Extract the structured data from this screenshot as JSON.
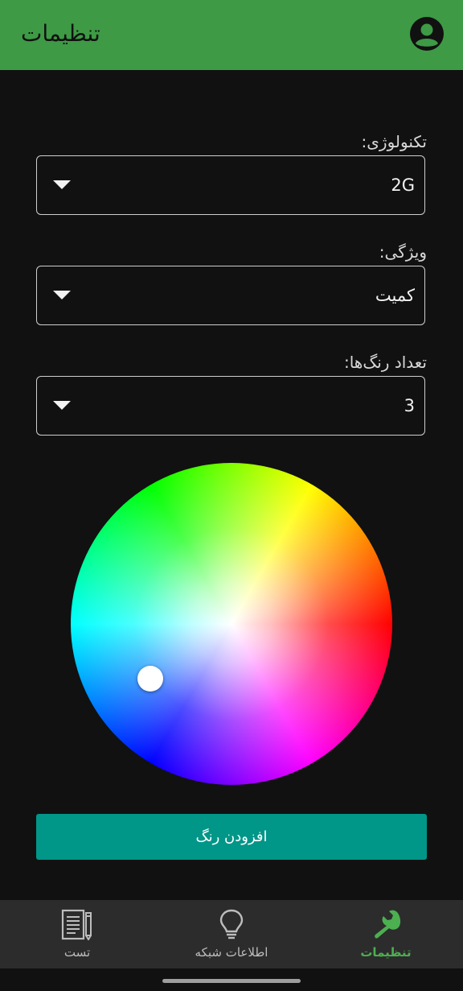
{
  "app_bar": {
    "title": "تنظیمات",
    "account_icon": "account-circle-icon"
  },
  "form": {
    "technology": {
      "label": "تکنولوژی:",
      "value": "2G"
    },
    "feature": {
      "label": "ویژگی:",
      "value": "کمیت"
    },
    "color_count": {
      "label": "تعداد رنگ‌ها:",
      "value": "3"
    }
  },
  "color_picker": {
    "type": "hsv-color-wheel",
    "selected_color": "#8ec8ff"
  },
  "add_color_button": {
    "label": "افزودن رنگ"
  },
  "bottom_nav": {
    "items": [
      {
        "label": "تست",
        "icon": "document-pencil-icon",
        "active": false
      },
      {
        "label": "اطلاعات شبکه",
        "icon": "lightbulb-icon",
        "active": false
      },
      {
        "label": "تنظیمات",
        "icon": "wrench-icon",
        "active": true
      }
    ]
  },
  "colors": {
    "app_bar": "#3e9a45",
    "background": "#111111",
    "button": "#009688",
    "active_nav": "#4caf50",
    "nav_background": "#2c2c2c"
  }
}
